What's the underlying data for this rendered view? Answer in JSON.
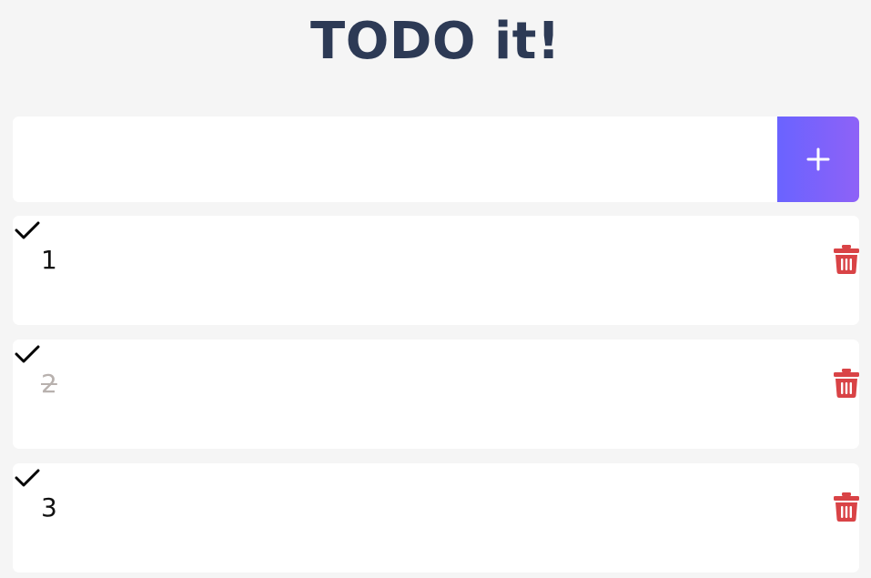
{
  "header": {
    "title": "TODO it!"
  },
  "new_todo": {
    "value": "",
    "placeholder": "",
    "add_icon": "plus-icon"
  },
  "colors": {
    "title": "#2d3a55",
    "add_button_start": "#6a63ff",
    "add_button_end": "#8e62f7",
    "delete": "#d94346",
    "done_text": "#b8b1ae"
  },
  "todos": [
    {
      "text": "1",
      "done": false,
      "check_icon": "check-icon",
      "delete_icon": "trash-icon"
    },
    {
      "text": "2",
      "done": true,
      "check_icon": "check-icon",
      "delete_icon": "trash-icon"
    },
    {
      "text": "3",
      "done": false,
      "check_icon": "check-icon",
      "delete_icon": "trash-icon"
    }
  ]
}
